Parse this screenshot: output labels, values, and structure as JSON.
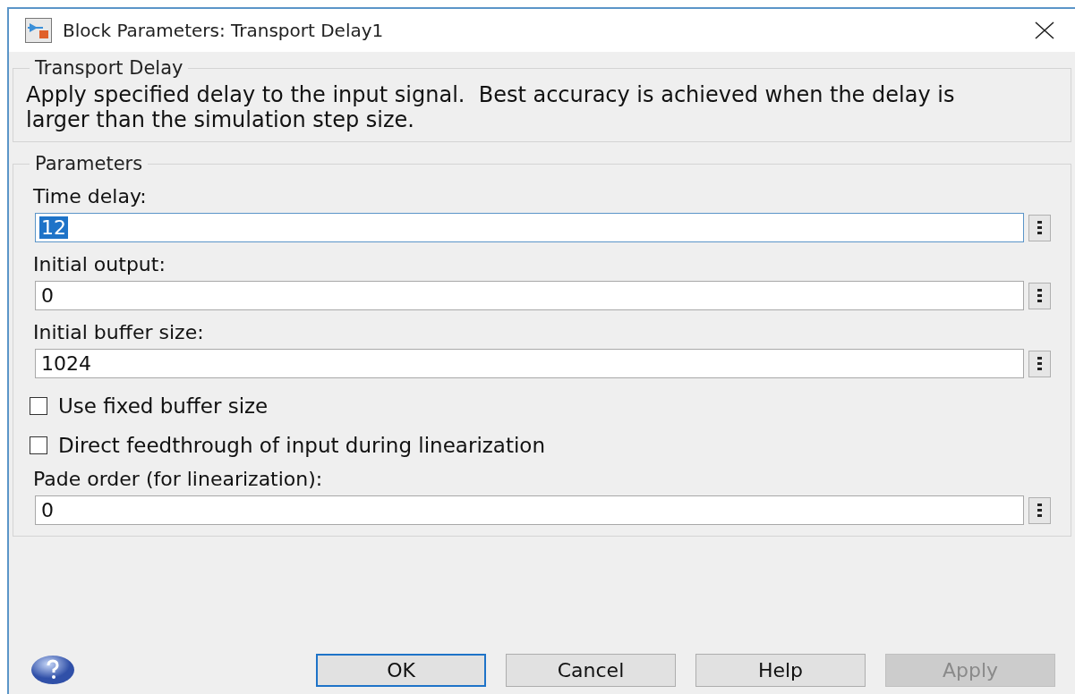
{
  "window": {
    "title": "Block Parameters: Transport Delay1"
  },
  "description_group": {
    "title": "Transport Delay",
    "text": "Apply specified delay to the input signal.  Best accuracy is achieved when the delay is larger than the simulation step size."
  },
  "parameters_group": {
    "title": "Parameters",
    "items": [
      {
        "kind": "field",
        "label": "Time delay:",
        "value": "12",
        "focused": true
      },
      {
        "kind": "field",
        "label": "Initial output:",
        "value": "0",
        "focused": false
      },
      {
        "kind": "field",
        "label": "Initial buffer size:",
        "value": "1024",
        "focused": false
      },
      {
        "kind": "checkbox",
        "label": "Use fixed buffer size",
        "checked": false
      },
      {
        "kind": "checkbox",
        "label": "Direct feedthrough of input during linearization",
        "checked": false
      },
      {
        "kind": "field",
        "label": "Pade order (for linearization):",
        "value": "0",
        "focused": false
      }
    ]
  },
  "buttons": [
    {
      "label": "OK",
      "default": true,
      "disabled": false
    },
    {
      "label": "Cancel",
      "default": false,
      "disabled": false
    },
    {
      "label": "Help",
      "default": false,
      "disabled": false
    },
    {
      "label": "Apply",
      "default": false,
      "disabled": true
    }
  ]
}
